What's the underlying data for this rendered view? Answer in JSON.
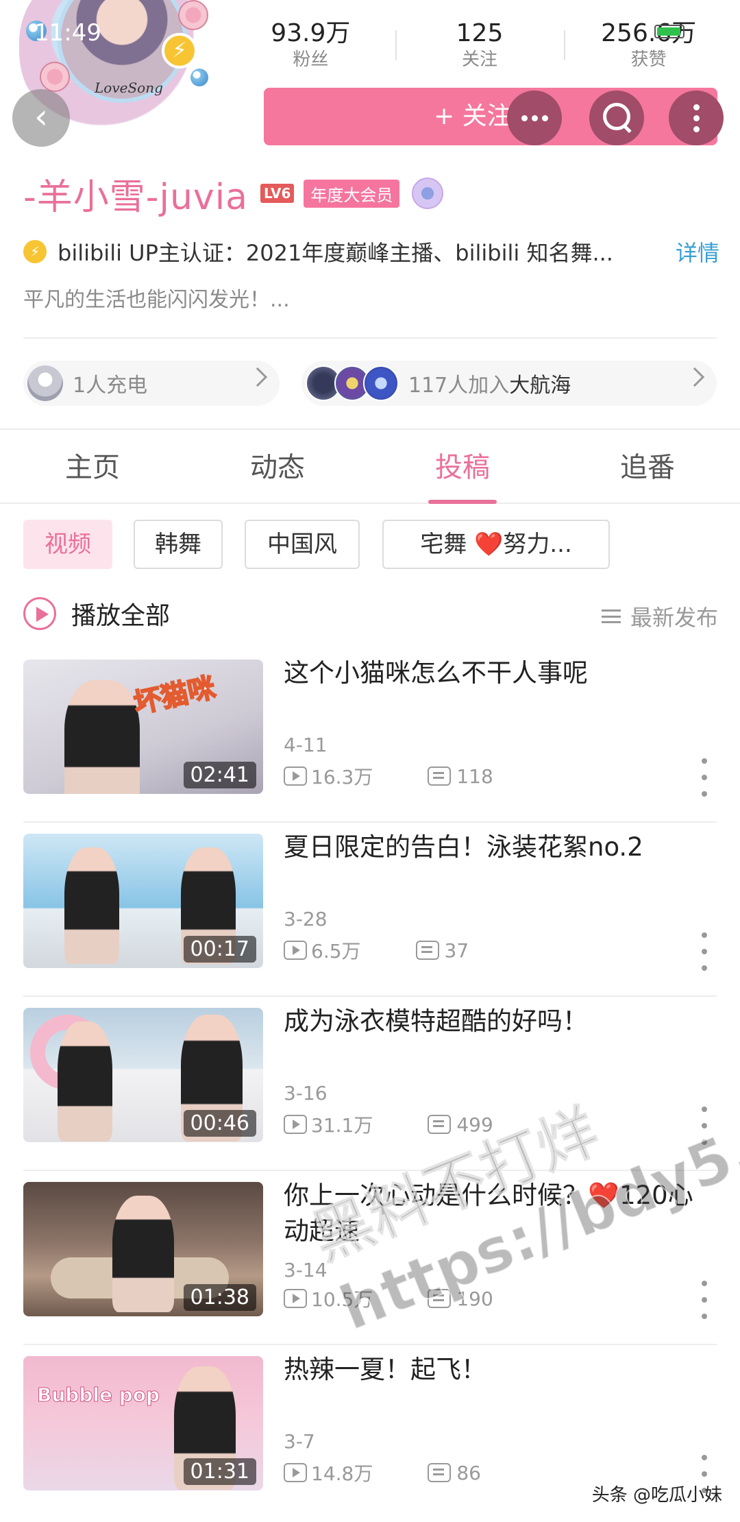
{
  "status_bar": {
    "time": "11:49",
    "battery_text": "100"
  },
  "profile": {
    "avatar_sign": "LoveSong",
    "stats": [
      {
        "value": "93.9万",
        "label": "粉丝"
      },
      {
        "value": "125",
        "label": "关注"
      },
      {
        "value": "256.6万",
        "label": "获赞"
      }
    ],
    "follow_label": "+ 关注",
    "username": "-羊小雪-juvia",
    "level_badge": "LV6",
    "vip_badge": "年度大会员",
    "certification": "bilibili UP主认证：2021年度巅峰主播、bilibili 知名舞...",
    "certification_more": "详情",
    "signature": "平凡的生活也能闪闪发光！...",
    "charge": {
      "count_text": "1人充电"
    },
    "guard": {
      "count_text": "117人加入",
      "name": "大航海"
    }
  },
  "tabs": [
    {
      "label": "主页",
      "active": false
    },
    {
      "label": "动态",
      "active": false
    },
    {
      "label": "投稿",
      "active": true
    },
    {
      "label": "追番",
      "active": false
    }
  ],
  "filters": [
    {
      "label": "视频",
      "active": true
    },
    {
      "label": "韩舞",
      "active": false
    },
    {
      "label": "中国风",
      "active": false
    },
    {
      "label": "宅舞 ❤️努力...",
      "active": false
    }
  ],
  "list_controls": {
    "play_all": "播放全部",
    "sort": "最新发布"
  },
  "videos": [
    {
      "title": "这个小猫咪怎么不干人事呢",
      "date": "4-11",
      "views": "16.3万",
      "comments": "118",
      "duration": "02:41",
      "thumb_text": "坏猫咪"
    },
    {
      "title": "夏日限定的告白！泳装花絮no.2",
      "date": "3-28",
      "views": "6.5万",
      "comments": "37",
      "duration": "00:17",
      "thumb_text": ""
    },
    {
      "title": "成为泳衣模特超酷的好吗！",
      "date": "3-16",
      "views": "31.1万",
      "comments": "499",
      "duration": "00:46",
      "thumb_text": ""
    },
    {
      "title": "你上一次心动是什么时候？❤️120心动超速",
      "date": "3-14",
      "views": "10.5万",
      "comments": "190",
      "duration": "01:38",
      "thumb_text": ""
    },
    {
      "title": "热辣一夏！起飞！",
      "date": "3-7",
      "views": "14.8万",
      "comments": "86",
      "duration": "01:31",
      "thumb_text": "Bubble pop"
    }
  ],
  "overlay": {
    "watermark_line1": "黑料不打烊",
    "watermark_line2": "https://bdy5.co",
    "credit": "头条 @吃瓜小妹"
  }
}
